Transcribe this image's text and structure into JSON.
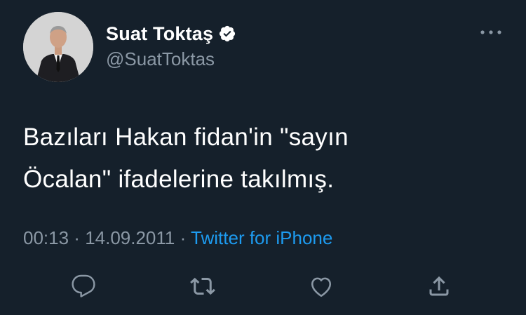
{
  "author": {
    "display_name": "Suat Toktaş",
    "handle": "@SuatToktas",
    "verified": true,
    "verified_icon": "verified-badge-icon"
  },
  "tweet": {
    "text": "Bazıları Hakan fidan'in \"sayın\nÖcalan\" ifadelerine takılmış."
  },
  "meta": {
    "time": "00:13",
    "separator": " · ",
    "date": "14.09.2011",
    "source": "Twitter for iPhone"
  },
  "actions": [
    {
      "name": "reply",
      "icon": "reply-icon"
    },
    {
      "name": "retweet",
      "icon": "retweet-icon"
    },
    {
      "name": "like",
      "icon": "heart-icon"
    },
    {
      "name": "share",
      "icon": "share-icon"
    }
  ],
  "colors": {
    "background": "#15202b",
    "text_primary": "#ffffff",
    "text_secondary": "#8b98a5",
    "accent": "#1d9bf0"
  }
}
